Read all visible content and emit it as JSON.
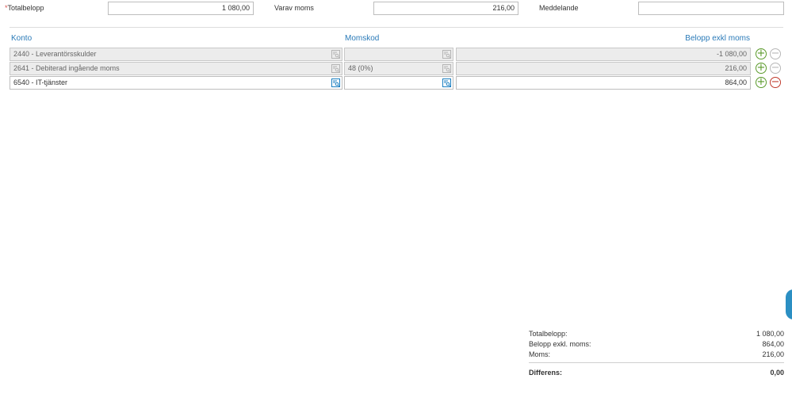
{
  "header": {
    "totalbelopp_required": "*",
    "totalbelopp_label": "Totalbelopp",
    "totalbelopp_value": "1 080,00",
    "varav_moms_label": "Varav moms",
    "varav_moms_value": "216,00",
    "meddelande_label": "Meddelande",
    "meddelande_value": ""
  },
  "table": {
    "columns": {
      "konto": "Konto",
      "momskod": "Momskod",
      "belopp": "Belopp exkl moms"
    },
    "rows": [
      {
        "konto": "2440 - Leverantörsskulder",
        "momskod": "",
        "belopp": "-1 080,00",
        "editable": false
      },
      {
        "konto": "2641 - Debiterad ingående moms",
        "momskod": "48 (0%)",
        "belopp": "216,00",
        "editable": false
      },
      {
        "konto": "6540 - IT-tjänster",
        "momskod": "",
        "belopp": "864,00",
        "editable": true
      }
    ]
  },
  "summary": {
    "totalbelopp_label": "Totalbelopp:",
    "totalbelopp_value": "1 080,00",
    "belopp_exkl_label": "Belopp exkl. moms:",
    "belopp_exkl_value": "864,00",
    "moms_label": "Moms:",
    "moms_value": "216,00",
    "differens_label": "Differens:",
    "differens_value": "0,00"
  },
  "icons": {
    "lookup": "search-list-icon",
    "add": "plus-circle-icon",
    "remove": "minus-circle-icon",
    "chat": "chat-tab-icon"
  },
  "colors": {
    "header_link": "#2a7ab8",
    "add_green": "#5a9a2a",
    "remove_red": "#c0392b",
    "lookup_blue": "#1b7fc1",
    "required_red": "#d9534f"
  }
}
